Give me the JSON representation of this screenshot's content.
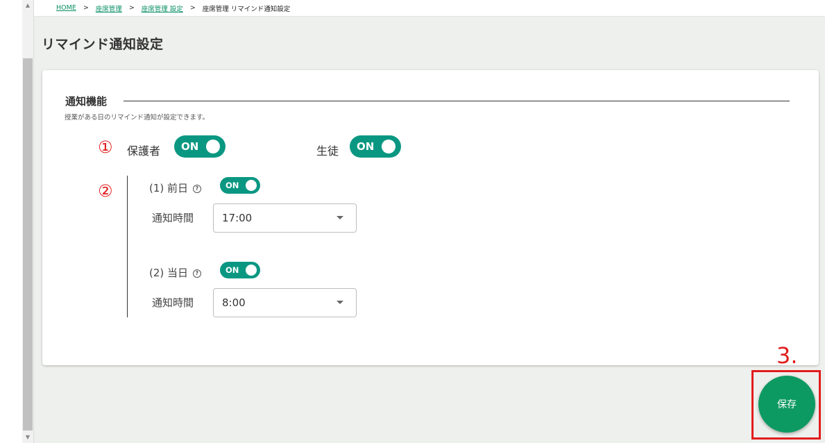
{
  "breadcrumb": {
    "home": "HOME",
    "seat_mgmt": "座席管理",
    "seat_settings": "座席管理 設定",
    "current": "座席管理 リマインド通知設定",
    "separator": ">"
  },
  "page": {
    "title": "リマインド通知設定"
  },
  "notification": {
    "section_title": "通知機能",
    "description": "授業がある日のリマインド通知が設定できます。",
    "marker1": "①",
    "marker2": "②",
    "guardian_label": "保護者",
    "guardian_toggle": "ON",
    "student_label": "生徒",
    "student_toggle": "ON",
    "prev_day": {
      "label": "(1) 前日",
      "toggle": "ON",
      "time_label": "通知時間",
      "time_value": "17:00"
    },
    "same_day": {
      "label": "(2) 当日",
      "toggle": "ON",
      "time_label": "通知時間",
      "time_value": "8:00"
    },
    "help_glyph": "?"
  },
  "annotation": {
    "step": "3."
  },
  "actions": {
    "save_label": "保存"
  },
  "colors": {
    "accent": "#0a9782",
    "save": "#0d9a62",
    "annotation": "#e11d1d",
    "link": "#0a8f66"
  }
}
